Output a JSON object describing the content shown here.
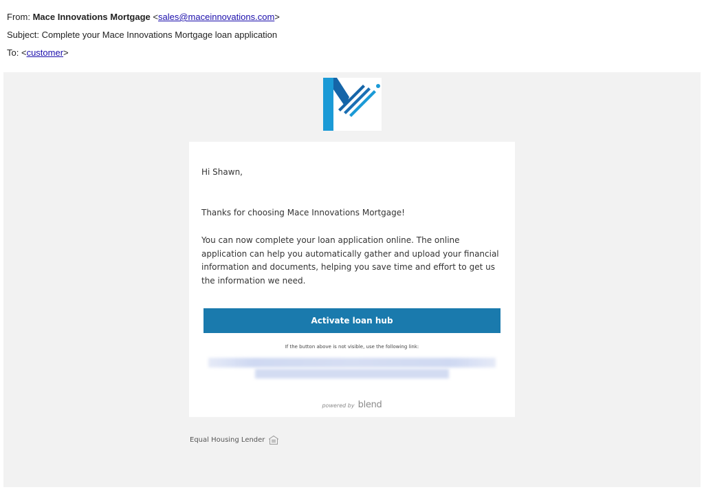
{
  "email": {
    "from_label": "From:",
    "from_name": "Mace Innovations Mortgage",
    "from_lt": "<",
    "from_address": "sales@maceinnovations.com",
    "from_gt": ">",
    "subject_label": "Subject:",
    "subject": "Complete your Mace Innovations Mortgage loan application",
    "to_label": "To:",
    "to_lt": "<",
    "to_address": "customer",
    "to_gt": ">"
  },
  "logo": {
    "icon": "mace-innovations-m-logo",
    "color_dark": "#1565a8",
    "color_light": "#1b9ad6"
  },
  "card": {
    "greeting": "Hi Shawn,",
    "thanks": "Thanks for choosing Mace Innovations Mortgage!",
    "paragraph": "You can now complete your loan application online. The online application can help you automatically gather and upload your financial information and documents, helping you save time and effort to get us the information we need.",
    "button_label": "Activate loan hub",
    "button_color": "#1a7aad",
    "fallback_note": "If the button above is not visible, use the following link:",
    "powered_by": "powered by",
    "powered_brand": "blend"
  },
  "footer": {
    "equal_housing": "Equal Housing Lender",
    "equal_housing_icon": "equal-housing-icon"
  }
}
